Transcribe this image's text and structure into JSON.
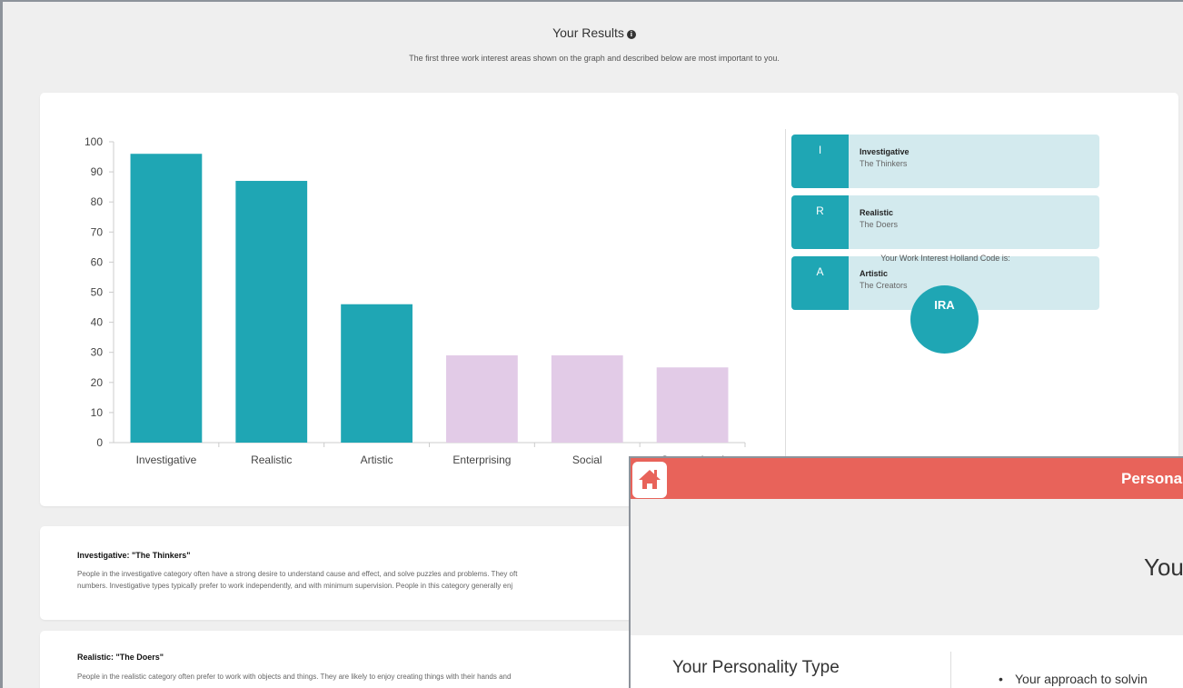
{
  "header": {
    "title": "Your Results",
    "info_icon": "info-icon",
    "subtitle": "The first three work interest areas shown on the graph and described below are most important to you."
  },
  "chart_data": {
    "type": "bar",
    "categories": [
      "Investigative",
      "Realistic",
      "Artistic",
      "Enterprising",
      "Social",
      "Conventional"
    ],
    "values": [
      96,
      87,
      46,
      29,
      29,
      25
    ],
    "colors": [
      "#1fa6b4",
      "#1fa6b4",
      "#1fa6b4",
      "#e2cbe7",
      "#e2cbe7",
      "#e2cbe7"
    ],
    "ylim": [
      0,
      100
    ],
    "yticks": [
      0,
      10,
      20,
      30,
      40,
      50,
      60,
      70,
      80,
      90,
      100
    ],
    "title": "",
    "xlabel": "",
    "ylabel": ""
  },
  "top_codes": [
    {
      "letter": "I",
      "name": "Investigative",
      "tagline": "The Thinkers"
    },
    {
      "letter": "R",
      "name": "Realistic",
      "tagline": "The Doers"
    },
    {
      "letter": "A",
      "name": "Artistic",
      "tagline": "The Creators"
    }
  ],
  "holland": {
    "label": "Your Work Interest Holland Code is:",
    "code": "IRA"
  },
  "descriptions": [
    {
      "title": "Investigative: \"The Thinkers\"",
      "line1": "People in the investigative category often have a strong desire to understand cause and effect, and solve puzzles and problems. They oft",
      "line2": "numbers. Investigative types typically prefer to work independently, and with minimum supervision. People in this category generally enj"
    },
    {
      "title": "Realistic: \"The Doers\"",
      "line1": "People in the realistic category often prefer to work with objects and things. They are likely to enjoy creating things with their hands and"
    }
  ],
  "overlay": {
    "home_icon": "home-icon",
    "title": "Persona",
    "heading": "You",
    "section": "Your Personality Type",
    "bullet": "Your approach to solvin",
    "accent": "#e8635a"
  }
}
